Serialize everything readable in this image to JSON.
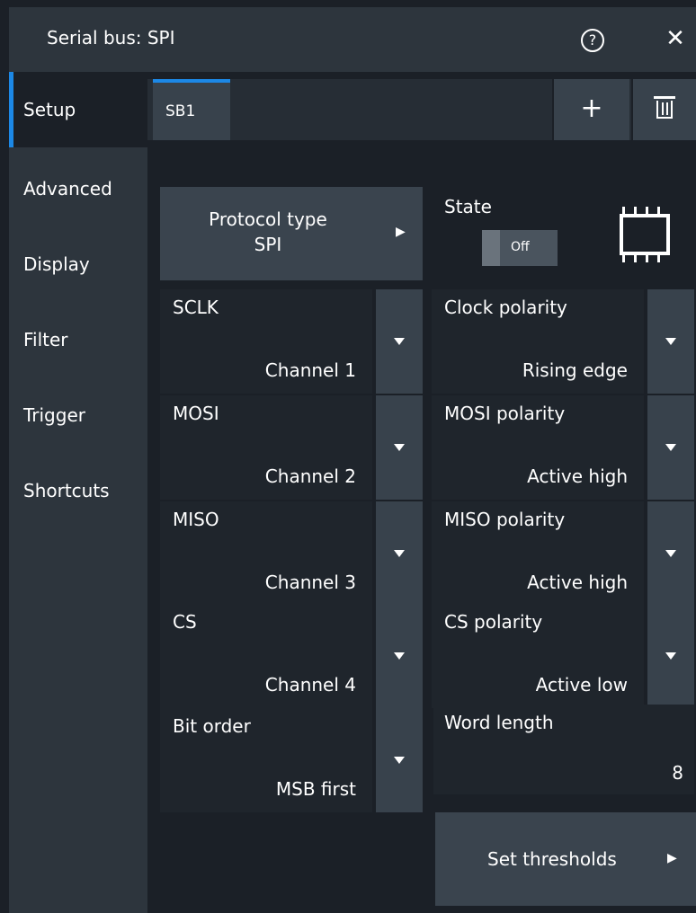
{
  "window": {
    "title": "Serial bus: SPI",
    "help_icon": "?",
    "close_icon": "✕"
  },
  "sidebar": {
    "items": [
      {
        "label": "Setup",
        "active": true
      },
      {
        "label": "Advanced",
        "active": false
      },
      {
        "label": "Display",
        "active": false
      },
      {
        "label": "Filter",
        "active": false
      },
      {
        "label": "Trigger",
        "active": false
      },
      {
        "label": "Shortcuts",
        "active": false
      }
    ]
  },
  "tabs": {
    "items": [
      {
        "label": "SB1",
        "active": true
      }
    ],
    "add_icon": "+"
  },
  "protocol": {
    "label": "Protocol type",
    "value": "SPI",
    "arrow": "▶"
  },
  "state": {
    "label": "State",
    "value": "Off"
  },
  "fields": [
    {
      "label": "SCLK",
      "value": "Channel 1"
    },
    {
      "label": "Clock polarity",
      "value": "Rising edge"
    },
    {
      "label": "MOSI",
      "value": "Channel 2"
    },
    {
      "label": "MOSI polarity",
      "value": "Active high"
    },
    {
      "label": "MISO",
      "value": "Channel 3"
    },
    {
      "label": "MISO polarity",
      "value": "Active high"
    },
    {
      "label": "CS",
      "value": "Channel 4"
    },
    {
      "label": "CS polarity",
      "value": "Active low"
    },
    {
      "label": "Bit order",
      "value": "MSB first"
    }
  ],
  "word_length": {
    "label": "Word length",
    "value": "8"
  },
  "thresholds": {
    "label": "Set thresholds",
    "arrow": "▶"
  },
  "colors": {
    "accent": "#1c88e6",
    "panel": "#2d353d",
    "background": "#1b2027",
    "button": "#3a444e"
  }
}
